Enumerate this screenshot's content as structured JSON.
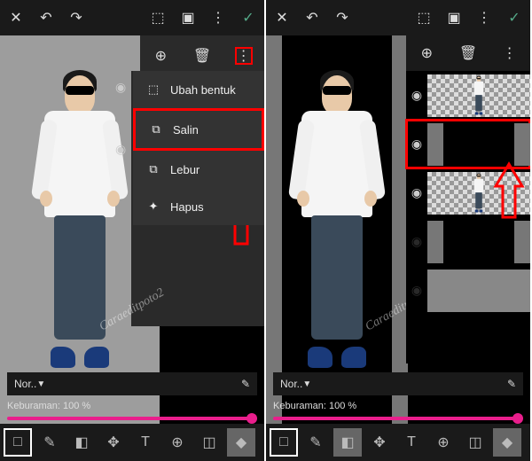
{
  "watermark": "Caraeditpoto2",
  "topbar": {
    "close": "✕",
    "undo": "↶",
    "redo": "↷",
    "crop": "⬚",
    "camera": "▣",
    "more": "⋮",
    "check": "✓"
  },
  "layerbar": {
    "add": "⊕",
    "trash": "🗑",
    "more": "⋮"
  },
  "menu": {
    "items": [
      {
        "icon": "⬚",
        "label": "Ubah bentuk"
      },
      {
        "icon": "⧉",
        "label": "Salin"
      },
      {
        "icon": "⧉",
        "label": "Lebur"
      },
      {
        "icon": "✦",
        "label": "Hapus"
      }
    ]
  },
  "blend": {
    "mode": "Nor..",
    "brush": "✎"
  },
  "opacity": {
    "label": "Keburaman:",
    "value": "100 %"
  },
  "bottom": {
    "tools": [
      "□",
      "✎",
      "◧",
      "✥",
      "T",
      "⊕",
      "◫",
      "◆"
    ]
  }
}
